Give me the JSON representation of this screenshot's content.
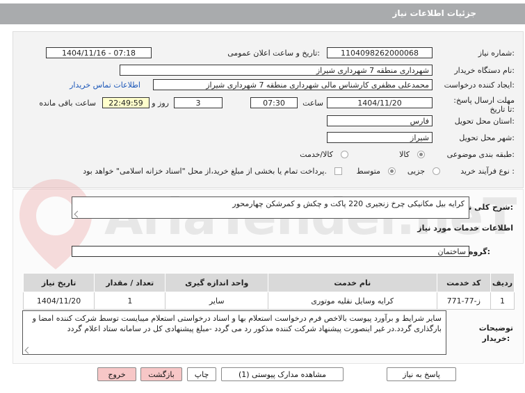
{
  "header": {
    "title": "جزئیات اطلاعات نیاز"
  },
  "form": {
    "need_number_label": "شماره نیاز:",
    "need_number": "1104098262000068",
    "announce_label": "تاریخ و ساعت اعلان عمومی:",
    "announce_value": "1404/11/16 - 07:18",
    "buyer_label": "نام دستگاه خریدار:",
    "buyer_value": "شهرداری منطقه 7 شهرداری شیراز",
    "creator_label": "ایجاد کننده درخواست:",
    "creator_value": "محمدعلی مظفری کارشناس مالی شهرداری منطقه 7 شهرداری شیراز",
    "contact_link": "اطلاعات تماس خریدار",
    "deadline_label": "مهلت ارسال پاسخ: تا تاریخ:",
    "deadline_date": "1404/11/20",
    "time_label": "ساعت",
    "deadline_time": "07:30",
    "days_value": "3",
    "days_label": "روز و",
    "remaining_time": "22:49:59",
    "remaining_label": "ساعت باقی مانده",
    "province_label": "استان محل تحویل:",
    "province_value": "فارس",
    "city_label": "شهر محل تحویل:",
    "city_value": "شیراز",
    "category_label": "طبقه بندی موضوعی:",
    "category_options": [
      "کالا",
      "کالا/خدمت"
    ],
    "purchase_type_label": "نوع فرآیند خرید :",
    "purchase_options": [
      "جزیی",
      "متوسط"
    ],
    "payment_note": "پرداخت تمام یا بخشی از مبلغ خرید،از محل \"اسناد خزانه اسلامی\" خواهد بود."
  },
  "summary": {
    "label": "شرح کلی نیاز:",
    "value": "کرایه بیل مکانیکی چرخ زنجیری 220 پاکت و چکش و کمرشکن چهارمحور"
  },
  "services": {
    "section_title": "اطلاعات خدمات مورد نیاز",
    "group_label": "گروه خدمت:",
    "group_value": "ساختمان",
    "columns": [
      "ردیف",
      "کد خدمت",
      "نام خدمت",
      "واحد اندازه گیری",
      "تعداد / مقدار",
      "تاریخ نیاز"
    ],
    "rows": [
      [
        "1",
        "ز-77-771",
        "کرایه وسایل نقلیه موتوری",
        "سایر",
        "1",
        "1404/11/20"
      ]
    ]
  },
  "buyer_notes": {
    "label_line1": "توضیحات",
    "label_line2": "خریدار:",
    "text": "سایر شرایط و برآورد پیوست  بالاخص فرم درخواست استعلام بها و اسناد درخواستی استعلام میبایست توسط شرکت کننده امضا و بارگذاری گردد.در غیر اینصورت پیشنهاد شرکت کننده مذکور رد می گردد -مبلغ پیشنهادی کل در سامانه ستاد اعلام گردد"
  },
  "buttons": {
    "reply": "پاسخ به نیاز",
    "attachments": "مشاهده مدارک پیوستی (1)",
    "print": "چاپ",
    "back": "بازگشت",
    "exit": "خروج"
  },
  "watermark": "AriaTender.neT",
  "colors": {
    "titlebar": "#a9abad",
    "link": "#1a56b8",
    "timer_bg": "#ffffcc",
    "pink_button": "#f7c7c7"
  }
}
